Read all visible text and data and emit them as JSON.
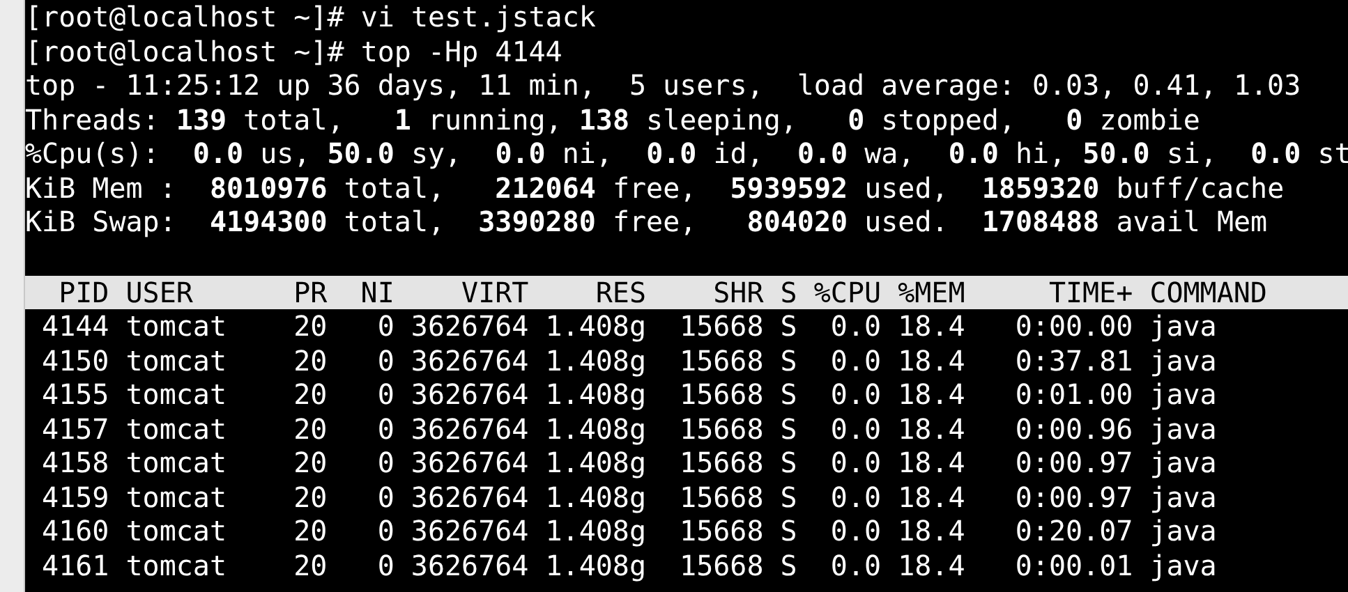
{
  "terminal": {
    "lines": [
      "[root@localhost ~]# vi test.jstack",
      "[root@localhost ~]# top -Hp 4144",
      "top - 11:25:12 up 36 days, 11 min,  5 users,  load average: 0.03, 0.41, 1.03",
      "Threads: **139** total,   **1** running, **138** sleeping,   **0** stopped,   **0** zombie",
      "%Cpu(s):  **0.0** us, **50.0** sy,  **0.0** ni,  **0.0** id,  **0.0** wa,  **0.0** hi, **50.0** si,  **0.0** st",
      "KiB Mem :  **8010976** total,   **212064** free,  **5939592** used,  **1859320** buff/cache",
      "KiB Swap:  **4194300** total,  **3390280** free,   **804020** used.  **1708488** avail Mem"
    ],
    "table": {
      "columns": [
        "PID",
        "USER",
        "PR",
        "NI",
        "VIRT",
        "RES",
        "SHR",
        "S",
        "%CPU",
        "%MEM",
        "TIME+",
        "COMMAND"
      ],
      "rows": [
        [
          "4144",
          "tomcat",
          "20",
          "0",
          "3626764",
          "1.408g",
          "15668",
          "S",
          "0.0",
          "18.4",
          "0:00.00",
          "java"
        ],
        [
          "4150",
          "tomcat",
          "20",
          "0",
          "3626764",
          "1.408g",
          "15668",
          "S",
          "0.0",
          "18.4",
          "0:37.81",
          "java"
        ],
        [
          "4155",
          "tomcat",
          "20",
          "0",
          "3626764",
          "1.408g",
          "15668",
          "S",
          "0.0",
          "18.4",
          "0:01.00",
          "java"
        ],
        [
          "4157",
          "tomcat",
          "20",
          "0",
          "3626764",
          "1.408g",
          "15668",
          "S",
          "0.0",
          "18.4",
          "0:00.96",
          "java"
        ],
        [
          "4158",
          "tomcat",
          "20",
          "0",
          "3626764",
          "1.408g",
          "15668",
          "S",
          "0.0",
          "18.4",
          "0:00.97",
          "java"
        ],
        [
          "4159",
          "tomcat",
          "20",
          "0",
          "3626764",
          "1.408g",
          "15668",
          "S",
          "0.0",
          "18.4",
          "0:00.97",
          "java"
        ],
        [
          "4160",
          "tomcat",
          "20",
          "0",
          "3626764",
          "1.408g",
          "15668",
          "S",
          "0.0",
          "18.4",
          "0:20.07",
          "java"
        ],
        [
          "4161",
          "tomcat",
          "20",
          "0",
          "3626764",
          "1.408g",
          "15668",
          "S",
          "0.0",
          "18.4",
          "0:00.01",
          "java"
        ]
      ]
    }
  }
}
